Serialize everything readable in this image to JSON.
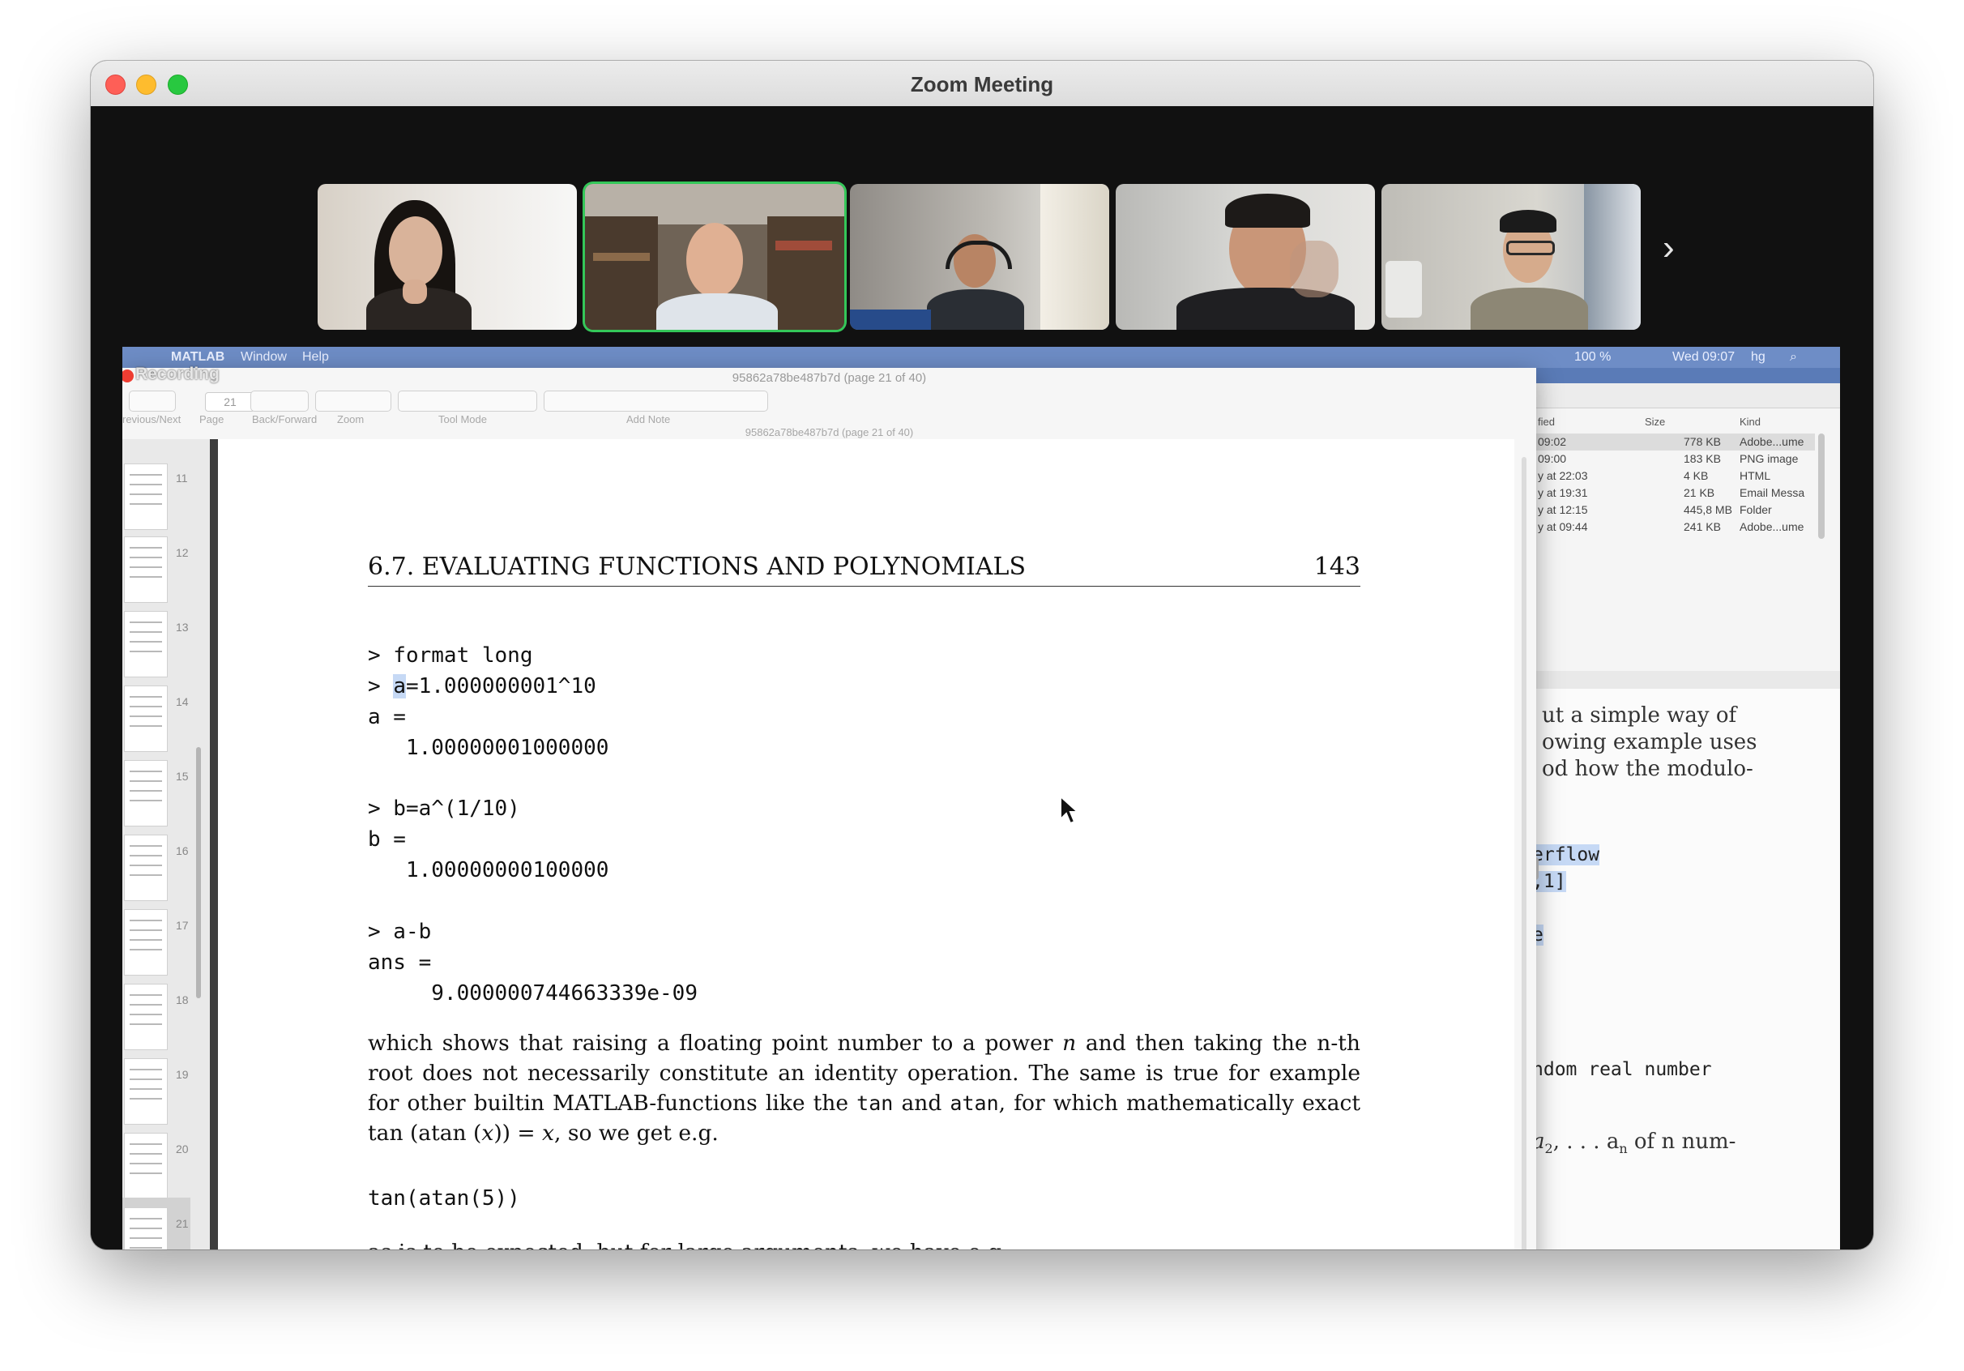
{
  "window": {
    "title": "Zoom Meeting"
  },
  "gallery": {
    "participants": [
      {
        "tile": "participant-1",
        "active": false
      },
      {
        "tile": "participant-2",
        "active": true
      },
      {
        "tile": "participant-3",
        "active": false
      },
      {
        "tile": "participant-4",
        "active": false
      },
      {
        "tile": "participant-5",
        "active": false
      }
    ],
    "next_icon": "chevron-right-icon"
  },
  "share": {
    "recording_label": "Recording",
    "menubar": {
      "items": [
        "MATLAB",
        "Window",
        "Help"
      ],
      "battery": "100 %",
      "datetime": "Wed 09:07",
      "user": "hg"
    },
    "preview": {
      "title": "95862a78be487b7d (page 21 of 40)",
      "subtitle": "95862a78be487b7d (page 21 of 40)",
      "page_field": "21",
      "toolbar_labels": [
        "revious/Next",
        "Page",
        "Back/Forward",
        "Zoom",
        "Tool Mode",
        "Add Note"
      ],
      "thumbnails": [
        "11",
        "12",
        "13",
        "14",
        "15",
        "16",
        "17",
        "18",
        "19",
        "20",
        "21"
      ],
      "page": {
        "header_section": "6.7.  EVALUATING FUNCTIONS AND POLYNOMIALS",
        "header_page": "143",
        "code_lines": [
          "> format long",
          "> ",
          "a",
          "=1.000000001^10",
          "a =",
          "   1.00000001000000",
          "> b=a^(1/10)",
          "b =",
          "   1.00000000100000",
          "> a-b",
          "ans =",
          "     9.000000744663339e-09"
        ],
        "paragraph": {
          "p1": "which shows that raising a floating point number to a power ",
          "n": "n",
          "p2": " and then taking the n-th root does not necessarily constitute an identity operation.  The same is true for example for other builtin MATLAB-functions like the ",
          "tan": "tan",
          "p3": " and ",
          "atan": "atan",
          "p4": ", for which mathematically exact ",
          "expr_a": "tan (atan (",
          "x1": "x",
          "expr_b": ")) = ",
          "x2": "x",
          "p5": ", so we get e.g."
        },
        "code_example": "tan(atan(5))",
        "last_line": "as is to be expected, but for large arguments, we have e.g."
      }
    },
    "finder": {
      "columns": [
        "fied",
        "Size",
        "Kind"
      ],
      "rows": [
        {
          "date": "09:02",
          "size": "778 KB",
          "kind": "Adobe...ume"
        },
        {
          "date": "09:00",
          "size": "183 KB",
          "kind": "PNG image"
        },
        {
          "date": "y at 22:03",
          "size": "4 KB",
          "kind": "HTML"
        },
        {
          "date": "y at 19:31",
          "size": "21 KB",
          "kind": "Email Messa"
        },
        {
          "date": "y at 12:15",
          "size": "445,8 MB",
          "kind": "Folder"
        },
        {
          "date": "y at 09:44",
          "size": "241 KB",
          "kind": "Adobe...ume"
        }
      ]
    },
    "background_doc": {
      "lines": [
        "ut a simple way of",
        "owing example uses",
        "od how the modulo-"
      ],
      "code_fragments": [
        "erflow",
        ",1]",
        "e",
        "ndom real number"
      ],
      "math_line_a": "a",
      "math_line_b": ", . . . a",
      "math_line_c": " of n num-",
      "sub_2": "2",
      "sub_n": "n"
    }
  }
}
